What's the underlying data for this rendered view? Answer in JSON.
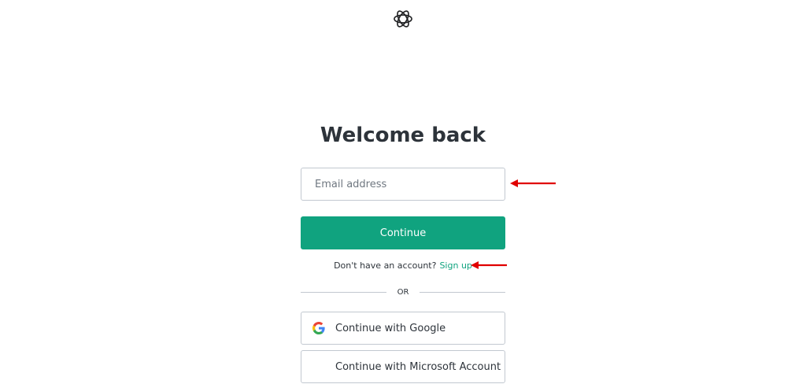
{
  "header": {
    "logo_icon": "openai-logo-icon"
  },
  "login": {
    "title": "Welcome back",
    "email_placeholder": "Email address",
    "email_value": "",
    "continue_label": "Continue",
    "signup_prompt": "Don't have an account?",
    "signup_link": "Sign up",
    "divider_text": "OR",
    "google_label": "Continue with Google",
    "microsoft_label": "Continue with Microsoft Account"
  },
  "colors": {
    "accent": "#10a37f",
    "border": "#c2c8d0",
    "text": "#2d333a",
    "annotation_arrow": "#e00000"
  },
  "icons": {
    "google": "google-g-icon",
    "microsoft": "microsoft-logo-icon",
    "annotation": "red-arrow-icon"
  }
}
